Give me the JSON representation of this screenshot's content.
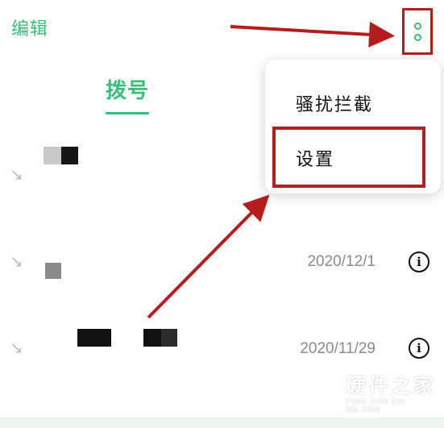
{
  "header": {
    "edit_label": "编辑",
    "more_icon": "more-vertical-icon"
  },
  "tabs": [
    {
      "label": "拨号",
      "active": true
    }
  ],
  "call_log": [
    {
      "date": "",
      "direction_icon": "incoming-call-icon"
    },
    {
      "date": "2020/12/1",
      "direction_icon": "incoming-call-icon",
      "info_icon": "info-icon"
    },
    {
      "date": "2020/11/29",
      "direction_icon": "incoming-call-icon",
      "info_icon": "info-icon"
    }
  ],
  "popup_menu": {
    "items": [
      {
        "label": "骚扰拦截"
      },
      {
        "label": "设置",
        "highlighted": true
      }
    ]
  },
  "watermark": {
    "title": "硬件之家",
    "subtitle": "YING JIAN ZHI JIA.COM"
  },
  "colors": {
    "accent": "#34c07a",
    "annotation": "#b51d1d",
    "date_text": "#8a8a8a"
  }
}
